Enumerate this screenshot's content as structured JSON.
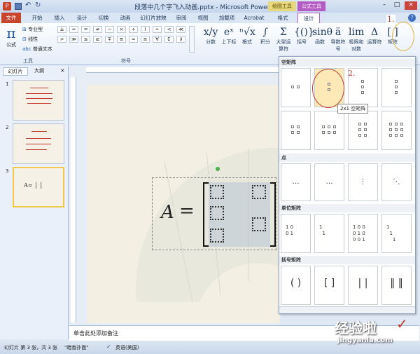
{
  "app": {
    "title": "段落中几个字飞入动画.pptx - Microsoft PowerPoint"
  },
  "tabs": {
    "file": "文件",
    "home": "开始",
    "insert": "插入",
    "design": "设计",
    "transitions": "切换",
    "animations": "动画",
    "slideshow": "幻灯片放映",
    "review": "审阅",
    "view": "视图",
    "addins": "加载项",
    "acrobat": "Acrobat",
    "format": "格式",
    "design2": "设计",
    "drawing_tools": "绘图工具",
    "equation_tools": "公式工具"
  },
  "ribbon": {
    "tools_group": "工具",
    "symbols_group": "符号",
    "formula": "公式",
    "professional": "专业型",
    "linear": "线性",
    "normal_text": "普通文本",
    "symbols_row1": [
      "±",
      "∞",
      "=",
      "≠",
      "~",
      "×",
      "÷",
      "!",
      "∝",
      "<",
      "≪"
    ],
    "symbols_row2": [
      ">",
      "≫",
      "≤",
      "≥",
      "∓",
      "≅",
      "≈",
      "≡",
      "∀",
      "∁",
      "∂"
    ],
    "structures": [
      {
        "glyph": "x/y",
        "label": "分数"
      },
      {
        "glyph": "eˣ",
        "label": "上下标"
      },
      {
        "glyph": "ⁿ√x",
        "label": "根式"
      },
      {
        "glyph": "∫",
        "label": "积分"
      },
      {
        "glyph": "Σ",
        "label": "大型运算符"
      },
      {
        "glyph": "{()}",
        "label": "括号"
      },
      {
        "glyph": "sinθ",
        "label": "函数"
      },
      {
        "glyph": "ä",
        "label": "导数符号"
      },
      {
        "glyph": "lim",
        "label": "极限和对数"
      },
      {
        "glyph": "Δ",
        "label": "运算符"
      },
      {
        "glyph": "[ ]",
        "label": "矩阵"
      }
    ]
  },
  "annotations": {
    "step1": "1.",
    "step2": "2."
  },
  "panel": {
    "tab_slides": "幻灯片",
    "tab_outline": "大纲",
    "slide_numbers": [
      "1",
      "2",
      "3"
    ]
  },
  "equation": {
    "lhs": "A",
    "eq": "="
  },
  "gallery": {
    "empty_matrix": "空矩阵",
    "dots": "点",
    "identity": "单位矩阵",
    "bracket_matrix": "括号矩阵",
    "tooltip": "2x1 空矩阵",
    "identity_cells": [
      [
        "1 0",
        "0 1"
      ],
      [
        "1",
        "  1"
      ],
      [
        "1 0 0",
        "0 1 0",
        "0 0 1"
      ],
      [
        "1",
        "  1",
        "    1"
      ]
    ]
  },
  "notes": {
    "placeholder": "单击此处添加备注"
  },
  "status": {
    "slide": "幻灯片 第 3 张，共 3 张",
    "theme": "\"暗香扑面\"",
    "lang": "英语(美国)"
  },
  "watermark": {
    "text": "经验啦",
    "url": "jingyanla.com"
  },
  "colors": {
    "accent_red": "#c0392b",
    "file_tab": "#c8442c",
    "context_tab": "#b45cc4"
  }
}
